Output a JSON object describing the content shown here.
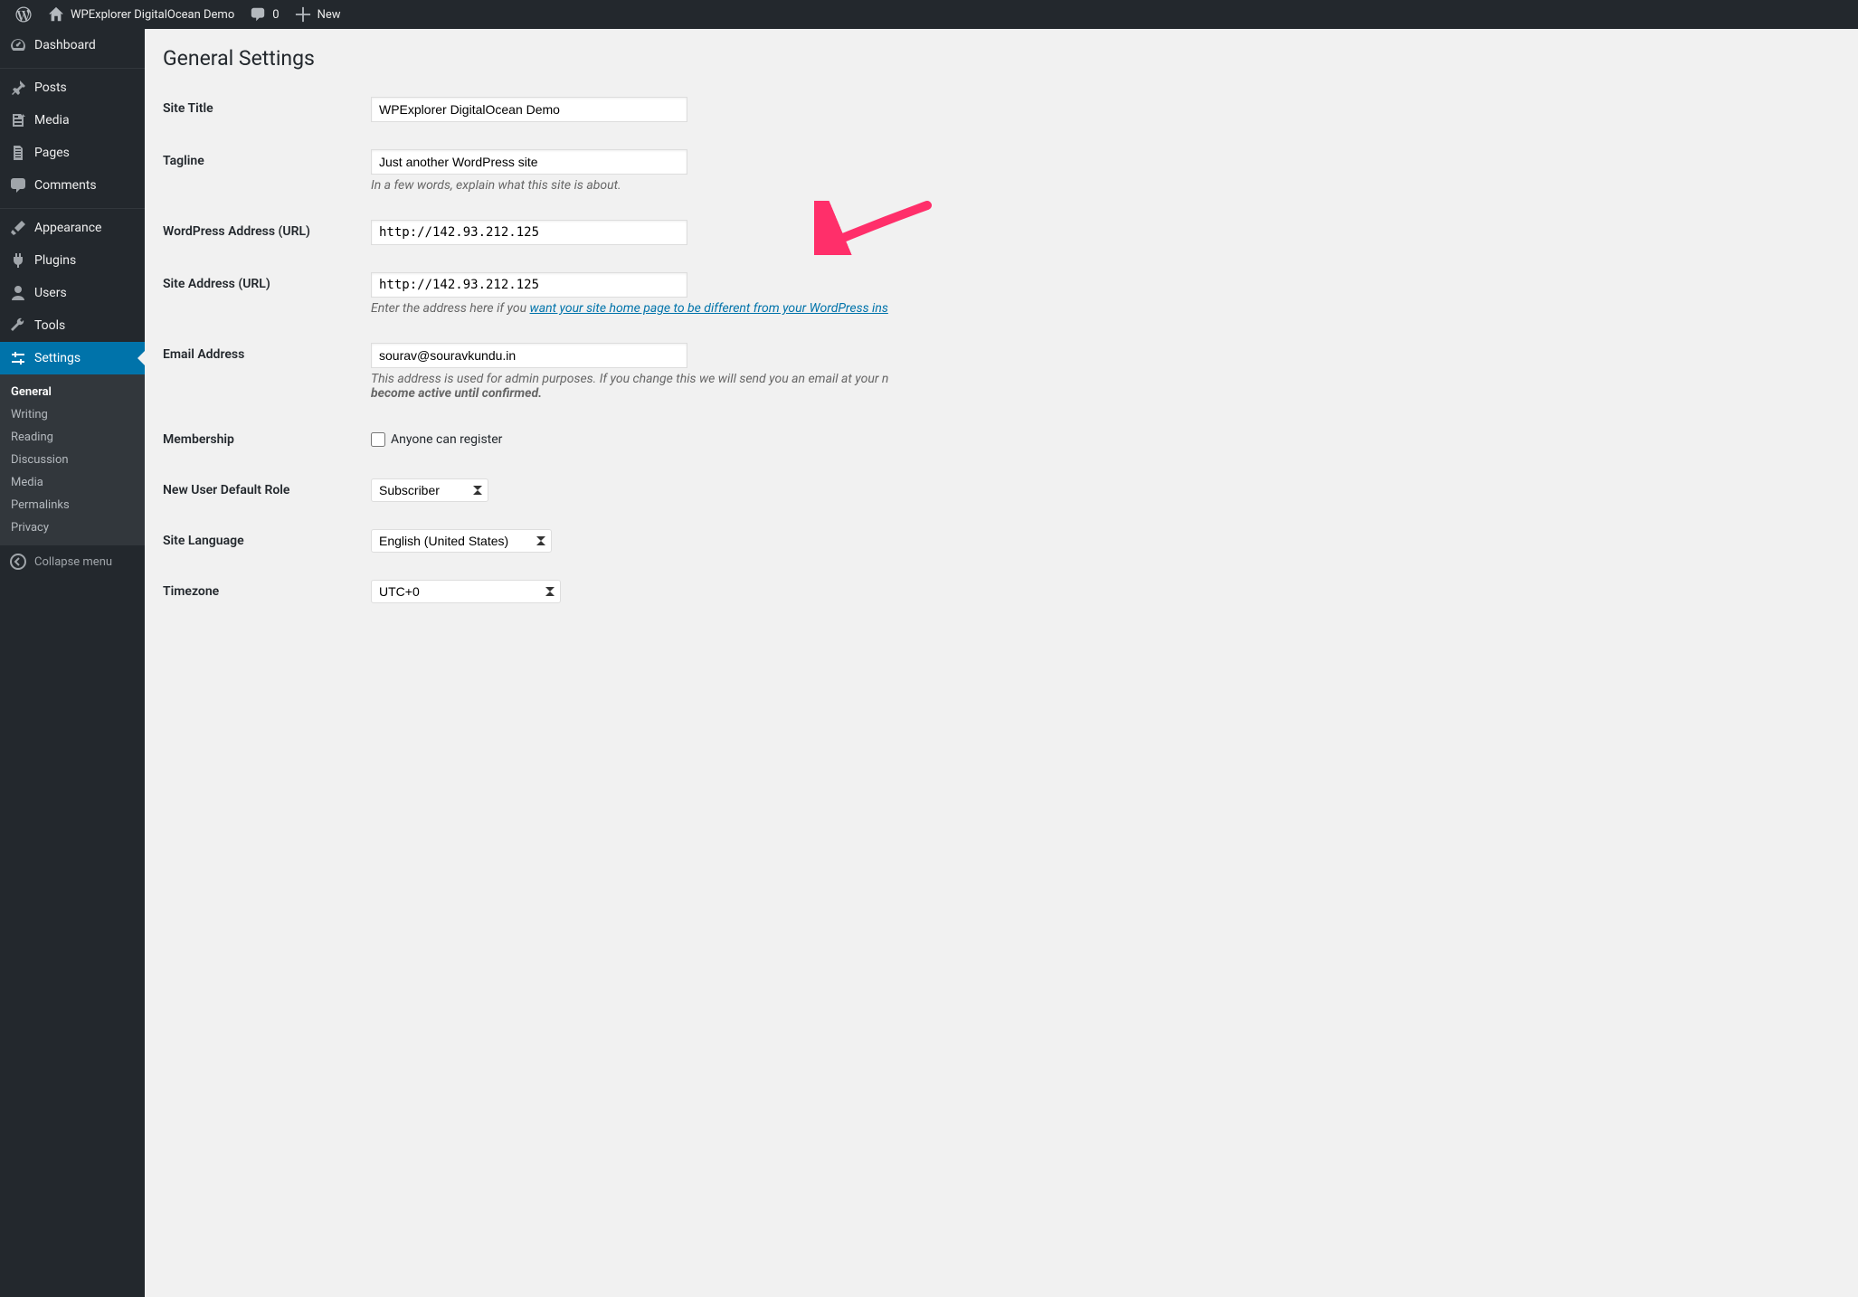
{
  "adminbar": {
    "site_name": "WPExplorer DigitalOcean Demo",
    "comments_count": "0",
    "new_label": "New"
  },
  "sidebar": {
    "items": [
      {
        "key": "dashboard",
        "label": "Dashboard"
      },
      {
        "key": "posts",
        "label": "Posts"
      },
      {
        "key": "media",
        "label": "Media"
      },
      {
        "key": "pages",
        "label": "Pages"
      },
      {
        "key": "comments",
        "label": "Comments"
      },
      {
        "key": "appearance",
        "label": "Appearance"
      },
      {
        "key": "plugins",
        "label": "Plugins"
      },
      {
        "key": "users",
        "label": "Users"
      },
      {
        "key": "tools",
        "label": "Tools"
      },
      {
        "key": "settings",
        "label": "Settings"
      }
    ],
    "submenu": [
      {
        "key": "general",
        "label": "General"
      },
      {
        "key": "writing",
        "label": "Writing"
      },
      {
        "key": "reading",
        "label": "Reading"
      },
      {
        "key": "discussion",
        "label": "Discussion"
      },
      {
        "key": "media",
        "label": "Media"
      },
      {
        "key": "permalinks",
        "label": "Permalinks"
      },
      {
        "key": "privacy",
        "label": "Privacy"
      }
    ],
    "collapse_label": "Collapse menu"
  },
  "page": {
    "title": "General Settings"
  },
  "fields": {
    "site_title": {
      "label": "Site Title",
      "value": "WPExplorer DigitalOcean Demo"
    },
    "tagline": {
      "label": "Tagline",
      "value": "Just another WordPress site",
      "description": "In a few words, explain what this site is about."
    },
    "wp_url": {
      "label": "WordPress Address (URL)",
      "value": "http://142.93.212.125"
    },
    "site_url": {
      "label": "Site Address (URL)",
      "value": "http://142.93.212.125",
      "description_prefix": "Enter the address here if you ",
      "description_link": "want your site home page to be different from your WordPress ins"
    },
    "email": {
      "label": "Email Address",
      "value": "sourav@souravkundu.in",
      "description_plain": "This address is used for admin purposes. If you change this we will send you an email at your n",
      "description_strong": "become active until confirmed."
    },
    "membership": {
      "label": "Membership",
      "checkbox_label": "Anyone can register",
      "checked": false
    },
    "default_role": {
      "label": "New User Default Role",
      "value": "Subscriber"
    },
    "language": {
      "label": "Site Language",
      "value": "English (United States)"
    },
    "timezone": {
      "label": "Timezone",
      "value": "UTC+0"
    }
  },
  "arrow": {
    "color": "#ff2f6a"
  }
}
